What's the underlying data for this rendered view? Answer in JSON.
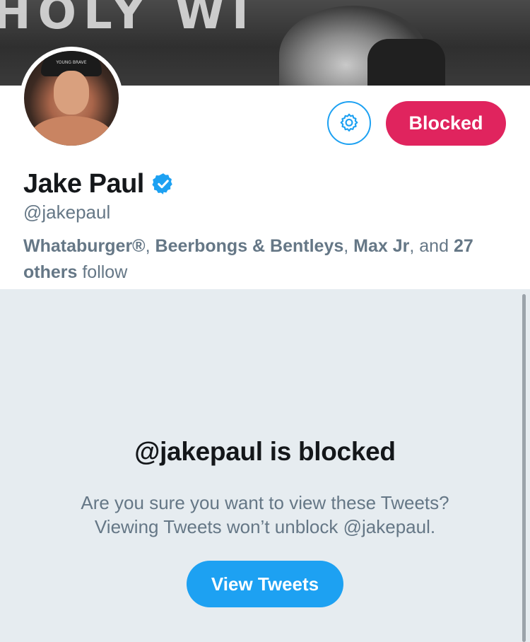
{
  "banner": {
    "stage_text": "HOLY WI"
  },
  "profile": {
    "name": "Jake Paul",
    "handle": "@jakepaul",
    "verified": true,
    "avatar_hat_text": "YOUNG BRAVE",
    "followers_known": [
      {
        "name": "Whataburger®",
        "sep": ", "
      },
      {
        "name": "Beerbongs & Bentleys",
        "sep": ", "
      },
      {
        "name": "Max Jr",
        "sep": ", and "
      }
    ],
    "followers_count_text": "27 others",
    "followers_suffix": " follow"
  },
  "actions": {
    "settings_icon": "gear-icon",
    "blocked_label": "Blocked"
  },
  "blocked_notice": {
    "title": "@jakepaul is blocked",
    "line1": "Are you sure you want to view these Tweets?",
    "line2": "Viewing Tweets won’t unblock @jakepaul.",
    "view_button_label": "View Tweets"
  },
  "colors": {
    "accent": "#1da1f2",
    "blocked": "#e0245e",
    "secondary_text": "#657786",
    "background": "#e6ecf0"
  }
}
